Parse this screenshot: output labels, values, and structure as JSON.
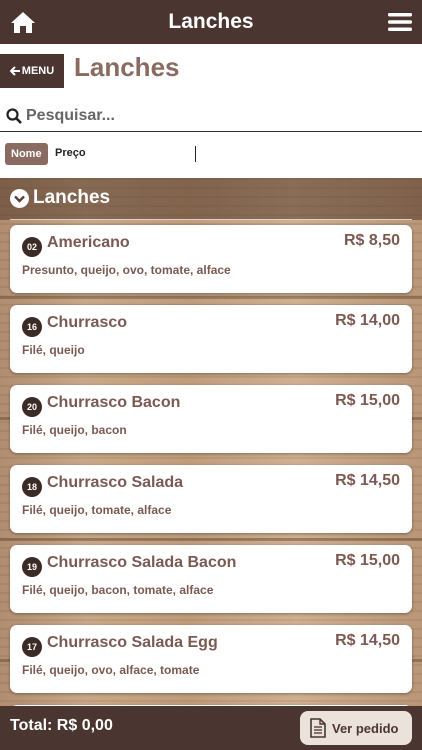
{
  "header": {
    "title": "Lanches",
    "home_icon": "home-icon",
    "menu_icon": "hamburger-menu-icon"
  },
  "subheader": {
    "menu_button_label": "MENU",
    "page_title": "Lanches"
  },
  "search": {
    "placeholder": "Pesquisar...",
    "value": ""
  },
  "sort": {
    "nome_label": "Nome",
    "preco_label": "Preço",
    "active": "Nome"
  },
  "category": {
    "title": "Lanches",
    "expanded": true
  },
  "items": [
    {
      "num": "02",
      "name": "Americano",
      "price": "R$ 8,50",
      "desc": "Presunto, queijo, ovo, tomate, alface"
    },
    {
      "num": "16",
      "name": "Churrasco",
      "price": "R$ 14,00",
      "desc": "Filé, queijo"
    },
    {
      "num": "20",
      "name": "Churrasco Bacon",
      "price": "R$ 15,00",
      "desc": "Filé, queijo, bacon"
    },
    {
      "num": "18",
      "name": "Churrasco Salada",
      "price": "R$ 14,50",
      "desc": "Filé, queijo, tomate, alface"
    },
    {
      "num": "19",
      "name": "Churrasco Salada Bacon",
      "price": "R$ 15,00",
      "desc": "Filé, queijo, bacon, tomate, alface"
    },
    {
      "num": "17",
      "name": "Churrasco Salada Egg",
      "price": "R$ 14,50",
      "desc": "Filé, queijo, ovo, alface, tomate"
    },
    {
      "num": "",
      "name": "",
      "price": "",
      "desc": ""
    }
  ],
  "footer": {
    "total_label": "Total: R$ 0,00",
    "ver_pedido_label": "Ver pedido"
  },
  "colors": {
    "bar": "#4a3530",
    "accent": "#8a6b62",
    "text_brown": "#7a5a52"
  }
}
